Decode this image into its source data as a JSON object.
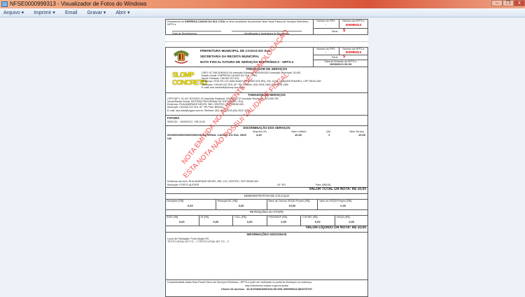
{
  "window": {
    "title": "NFSE0000999313 - Visualizador de Fotos do Windows",
    "minimize": "–",
    "restore": "❐",
    "close": "x"
  },
  "toolbar": {
    "items": [
      "Arquivo ▾",
      "Imprimir ▾",
      "Email",
      "Gravar ▾",
      "Abrir ▾"
    ]
  },
  "receipt": {
    "text_pre": "Recebemos de",
    "company": "EMPRESA CAIXAS DO SUL LTDA",
    "text_post": "os itens constantes da presente Nota Fiscal Fatura de Serviços Eletrônica - NFFS-e",
    "date_label": "Data de Recebimento",
    "sign_label": "Identificação e Assinatura do Recebedor",
    "rps_label": "Número do RPS",
    "rps_value": "-",
    "nf_label": "Número da NFFS-e",
    "nf_value": "000999313",
    "serie_label": "Série:",
    "serie_value": "S"
  },
  "header": {
    "line1": "PREFEITURA MUNICIPAL DE CAXIAS DO SUL",
    "line2": "SECRETARIA DA RECEITA MUNICIPAL",
    "line3": "NOTA FISCAL FATURA DE SERVIÇOS ELETRÔNICA - NFFS-e",
    "rps_label": "Número do RPS",
    "rps_value": "-",
    "nf_label": "Número da NFFS-e",
    "nf_value": "000999313",
    "serie_label": "Série:",
    "serie_value": "S",
    "date_label": "Data de Emissão da NFFS-e",
    "date_value": "19/08/2013 09:03"
  },
  "prestador": {
    "title": "PRESTADOR DE SERVIÇOS",
    "logo": "SLOMP CONCRETO",
    "lines": [
      "CNPJ: 87.268.304/0001-94   Inscrição Estadual: 029/0003424   Inscrição Municipal: 26.481",
      "Razão Social: EMPRESA CAIXAS DO SUL LTDA",
      "Nome Fantasia: CAIXAS DO SUL",
      "Endereço: ROD RS-122 (MACHADO DE ASSIS ATE BR), KM, 4146, CINQUENTENARIO, CEP 95010-550",
      "Município: CAIXAS DO SUL   UF: RS   Telefone: (54) 3206 1483  (54) 3206 1480",
      "E-mail: ana.zambelli@slomp.com   Site:"
    ]
  },
  "tomador": {
    "title": "TOMADOR DE SERVIÇOS",
    "lines": [
      "CPF/CNPJ: 91.447.307/0001-03   Inscrição Estadual: 029/0033712   Inscrição Municipal: 123.456.789",
      "Nome/Razão Social: SISTEMA PROGRAMA DE SOFTWARE LTDA",
      "Endereço: RUA ANDRADE NEVES, 580, CENTRO, CEP 95180-000",
      "Município: CAXIAS DO SUL   UF: RS   País: BRASIL",
      "E-mail: ana.silva@cigam.com.br   Telefone: (54) 3022 4216  (54) 3022 4216"
    ]
  },
  "fatura": {
    "title": "FATURA",
    "line": "999313/1 - 19/09/2013 - R$ 10,00"
  },
  "servicos": {
    "title": "DISCRIMINAÇÃO DOS SERVIÇOS",
    "headers": [
      "Alíquota (%)",
      "Valor Unitário",
      "Qtd",
      "Valor Serviço"
    ],
    "item": {
      "desc": "0000000000000000000208 MATERIAL CAIXAS DO SUL 2525 UN",
      "aliquota": "4,00",
      "unit": "10,00",
      "qtd": "1",
      "valor": "10,00"
    },
    "obra": "Endereço da obra: RUA ANDRADE NEVES, 580, 123, CENTRO, CEP 95180-000",
    "municipio": "Município: PORTO ALEGRE",
    "uf": "UF: RS",
    "pais": "País: BRASIL"
  },
  "total": "VALOR TOTAL DA NOTA: R$ 10,00",
  "calculo": {
    "title": "DEMONSTRATIVO DE CÁLCULO",
    "cells": [
      {
        "label": "Deduções (R$):",
        "value": "0,00"
      },
      {
        "label": "Redução BC (R$):",
        "value": "0,00"
      },
      {
        "label": "Base de Cálculo ISSQN Próprio (R$):",
        "value": "10,00"
      },
      {
        "label": "Valor do ISSQN Próprio (R$):",
        "value": "0,40"
      }
    ]
  },
  "retencoes": {
    "title": "RETENÇÕES NA FONTE",
    "cells": [
      {
        "label": "INSS (R$):",
        "value": "0,00"
      },
      {
        "label": "IR (R$):",
        "value": "0,00"
      },
      {
        "label": "CSLL (R$):",
        "value": "0,00"
      },
      {
        "label": "PIS/PASEP (R$):",
        "value": "0,00"
      },
      {
        "label": "COFINS (R$):",
        "value": "0,00"
      },
      {
        "label": "ISSQN (R$):",
        "value": "0,00"
      }
    ]
  },
  "liquido": "VALOR LÍQUIDO DA NOTA: R$ 10,00",
  "info": {
    "title": "INFORMAÇÕES ADICIONAIS",
    "lines": [
      "Local da Tributação: Porto Alegre-RS",
      "TEXTO LEGAL DO T.O. - 1 TEXTO LEGAL DO T.O. - 2"
    ]
  },
  "footer": {
    "line1": "A autenticidade desta Nota Fiscal Fatura de Serviços Eletrônica - NFFS-e pode ser verificada no portal do Município no endereço:",
    "url": "http://nfsehomol.caxias.rs.gov.br/portal",
    "key_label": "Chave de acesso:",
    "key": "43-87268304000194-99-S00-000999313-882073797"
  },
  "watermark": {
    "line1": "NOTA EMITIDA NO AMBIENTE DE HOMOLOGAÇÃO",
    "line2": "ESTA NOTA NÃO POSSUI VALIDADE FISCAL"
  }
}
